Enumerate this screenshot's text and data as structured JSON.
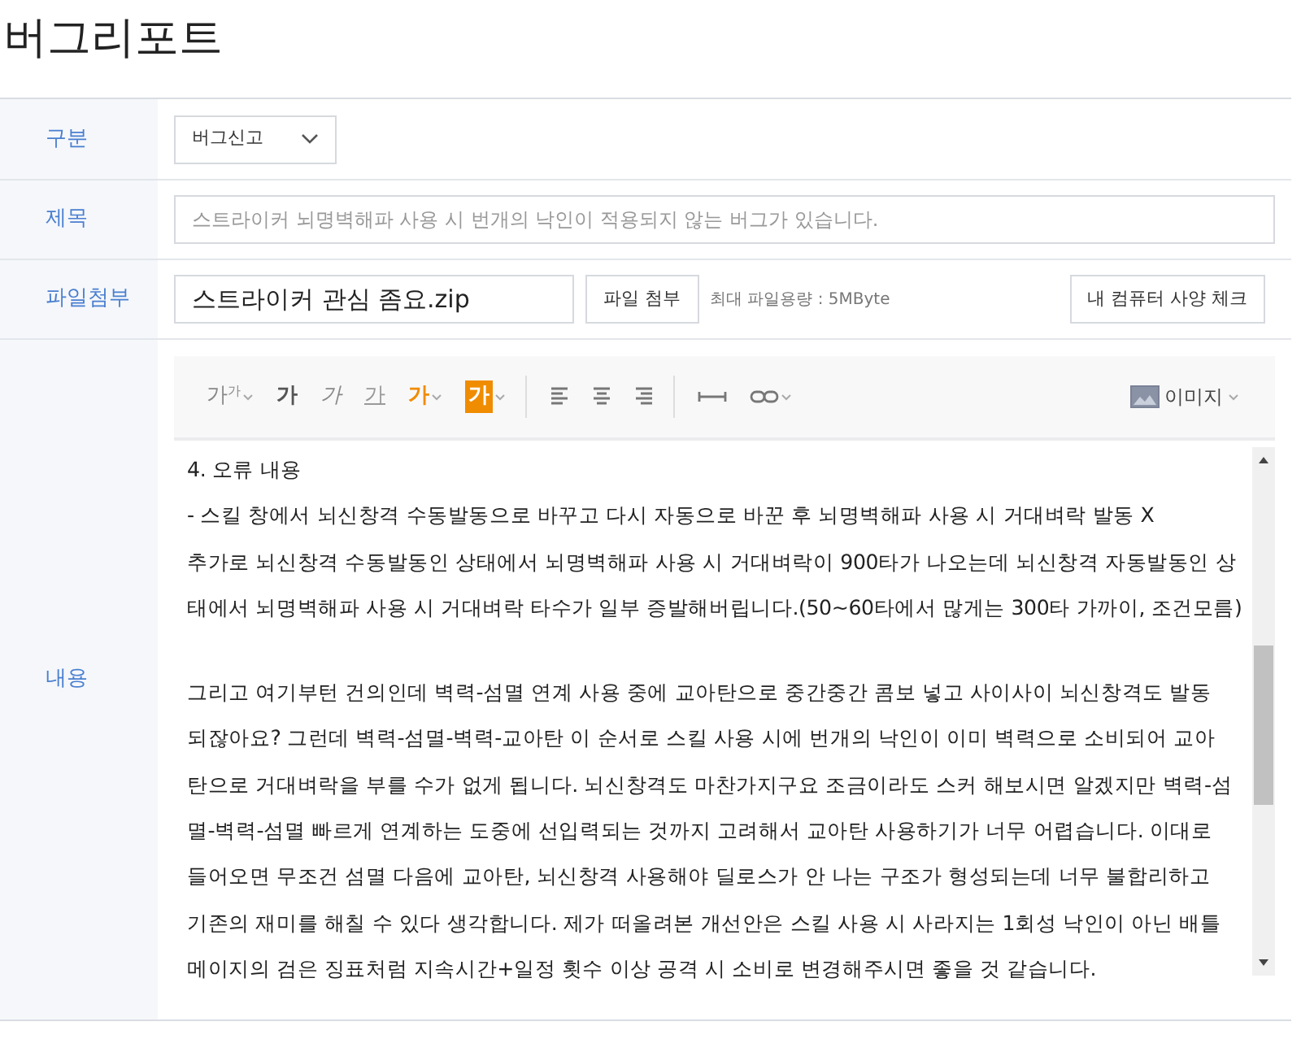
{
  "page_title": "버그리포트",
  "form": {
    "category": {
      "label": "구분",
      "value": "버그신고"
    },
    "subject": {
      "label": "제목",
      "placeholder": "스트라이커 뇌명벽해파 사용 시 번개의 낙인이 적용되지 않는 버그가 있습니다."
    },
    "attachment": {
      "label": "파일첨부",
      "file_name": "스트라이커 관심 좀요.zip",
      "attach_button": "파일 첨부",
      "limit_note": "최대 파일용량 : 5MByte",
      "spec_check_button": "내 컴퓨터 사양 체크"
    },
    "content": {
      "label": "내용",
      "toolbar_groups": [
        [
          {
            "kind": "font-size",
            "label": "가$^{가}$",
            "has_caret": true
          },
          {
            "kind": "bold",
            "label": "가",
            "has_caret": false
          },
          {
            "kind": "italic",
            "label": "가",
            "has_caret": false
          },
          {
            "kind": "underline",
            "label": "가",
            "has_caret": false
          },
          {
            "kind": "text-color",
            "label": "가",
            "has_caret": true
          },
          {
            "kind": "highlight",
            "label": "가",
            "has_caret": true
          }
        ],
        [
          {
            "kind": "align-left",
            "has_caret": false
          },
          {
            "kind": "align-center",
            "has_caret": false
          },
          {
            "kind": "align-right",
            "has_caret": false
          }
        ],
        [
          {
            "kind": "horizontal-rule",
            "has_caret": false
          },
          {
            "kind": "link",
            "has_caret": true
          }
        ]
      ],
      "image_button": {
        "label": "이미지",
        "has_caret": true
      },
      "paragraphs": [
        [
          "4. 오류 내용",
          "- 스킬 창에서 뇌신창격 수동발동으로 바꾸고 다시 자동으로 바꾼 후 뇌명벽해파 사용 시 거대벼락 발동 X",
          "추가로 뇌신창격 수동발동인 상태에서 뇌명벽해파 사용 시 거대벼락이 900타가 나오는데 뇌신창격 자동발동인 상",
          "태에서 뇌명벽해파 사용 시 거대벼락 타수가 일부 증발해버립니다.(50~60타에서 많게는 300타 가까이, 조건모름)"
        ],
        [
          "그리고 여기부턴 건의인데 벽력-섬멸 연계 사용 중에 교아탄으로 중간중간 콤보 넣고 사이사이 뇌신창격도 발동",
          "되잖아요? 그런데 벽력-섬멸-벽력-교아탄 이 순서로 스킬 사용 시에 번개의 낙인이 이미 벽력으로 소비되어 교아",
          "탄으로 거대벼락을 부를 수가 없게 됩니다. 뇌신창격도 마찬가지구요 조금이라도 스커 해보시면 알겠지만 벽력-섬",
          "멸-벽력-섬멸 빠르게 연계하는 도중에 선입력되는 것까지 고려해서 교아탄 사용하기가 너무 어렵습니다. 이대로",
          "들어오면 무조건 섬멸 다음에 교아탄, 뇌신창격 사용해야 딜로스가 안 나는 구조가 형성되는데 너무 불합리하고",
          "기존의 재미를 해칠 수 있다 생각합니다. 제가 떠올려본 개선안은 스킬 사용 시 사라지는 1회성 낙인이 아닌 배틀",
          "메이지의 검은 징표처럼 지속시간+일정 횟수 이상 공격 시 소비로 변경해주시면 좋을 것 같습니다."
        ]
      ]
    }
  }
}
